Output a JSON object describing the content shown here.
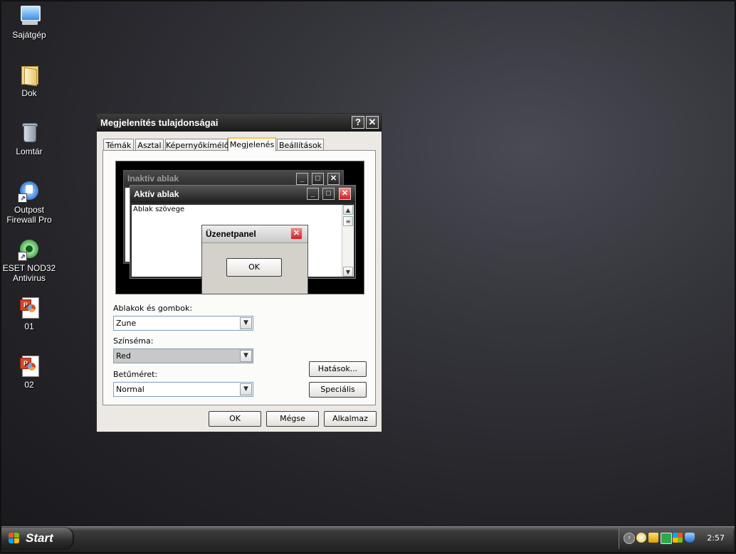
{
  "desktop": {
    "icons": [
      {
        "label": "Sajátgép"
      },
      {
        "label": "Dok"
      },
      {
        "label": "Lomtár"
      },
      {
        "label": "Outpost Firewall Pro"
      },
      {
        "label": "ESET NOD32 Antivirus"
      },
      {
        "label": "01"
      },
      {
        "label": "02"
      }
    ]
  },
  "dialog": {
    "title": "Megjelenítés tulajdonságai",
    "help_label": "?",
    "close_label": "✕",
    "tabs": [
      {
        "label": "Témák"
      },
      {
        "label": "Asztal"
      },
      {
        "label": "Képernyőkímélő"
      },
      {
        "label": "Megjelenés"
      },
      {
        "label": "Beállítások"
      }
    ],
    "active_tab": "Megjelenés",
    "preview": {
      "inactive_title": "Inaktív ablak",
      "active_title": "Aktív ablak",
      "window_text": "Ablak szövege",
      "message_title": "Üzenetpanel",
      "message_ok": "OK"
    },
    "fields": {
      "windows_buttons_label": "Ablakok és gombok:",
      "windows_buttons_value": "Zune",
      "color_scheme_label": "Színséma:",
      "color_scheme_value": "Red",
      "font_size_label": "Betűméret:",
      "font_size_value": "Normal"
    },
    "effects_button": "Hatások...",
    "advanced_button": "Speciális",
    "ok_button": "OK",
    "cancel_button": "Mégse",
    "apply_button": "Alkalmaz"
  },
  "taskbar": {
    "start_label": "Start",
    "clock": "2:57"
  },
  "colors": {
    "titlebar": "#1a1a1a",
    "active_tab_accent": "#ffc73c",
    "close_red": "#c22222"
  }
}
